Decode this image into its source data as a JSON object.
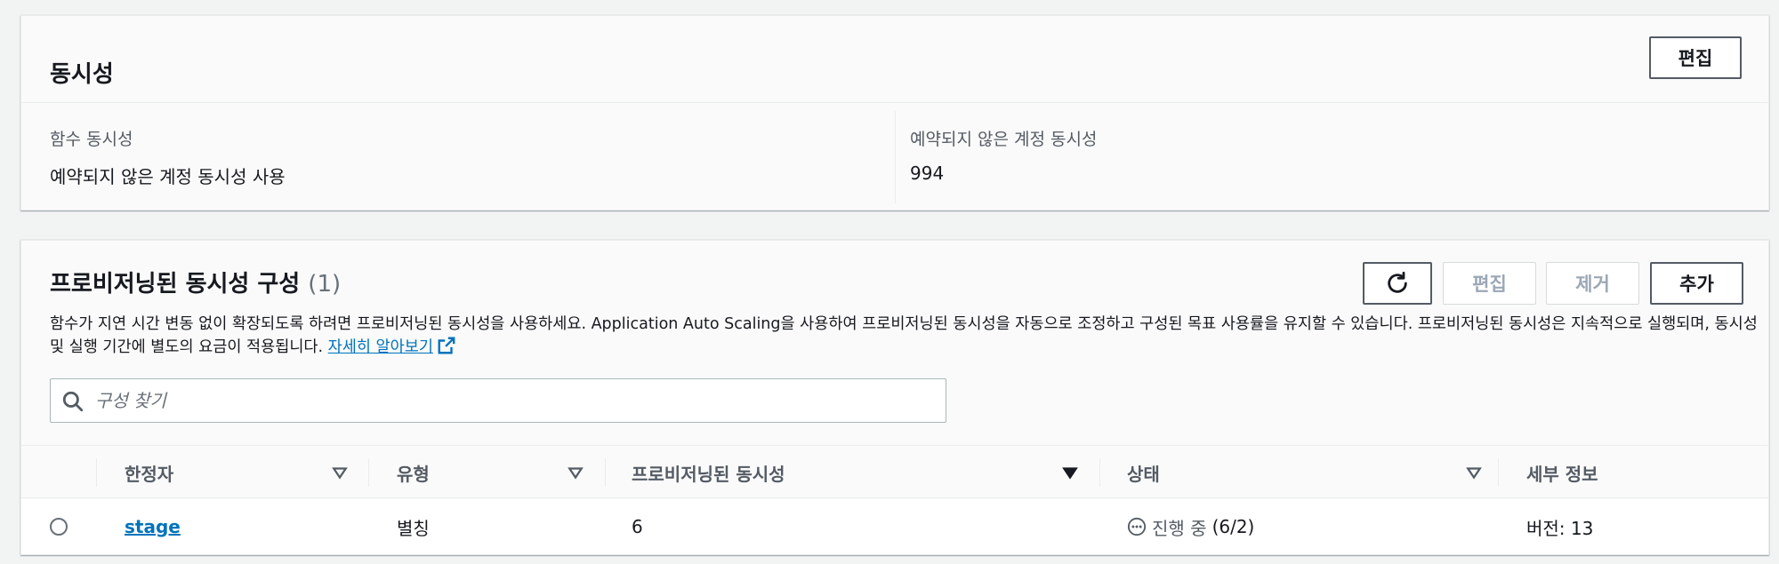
{
  "concurrency": {
    "title": "동시성",
    "edit_label": "편집",
    "function_concurrency_label": "함수 동시성",
    "function_concurrency_value": "예약되지 않은 계정 동시성 사용",
    "unreserved_label": "예약되지 않은 계정 동시성",
    "unreserved_value": "994"
  },
  "provisioned": {
    "title": "프로비저닝된 동시성 구성",
    "count": "(1)",
    "description": "함수가 지연 시간 변동 없이 확장되도록 하려면 프로비저닝된 동시성을 사용하세요. Application Auto Scaling을 사용하여 프로비저닝된 동시성을 자동으로 조정하고 구성된 목표 사용률을 유지할 수 있습니다. 프로비저닝된 동시성은 지속적으로 실행되며, 동시성 및 실행 기간에 별도의 요금이 적용됩니다.",
    "learn_more": "자세히 알아보기",
    "buttons": {
      "refresh_icon": "refresh-icon",
      "edit": "편집",
      "remove": "제거",
      "add": "추가"
    },
    "search": {
      "placeholder": "구성 찾기",
      "value": ""
    },
    "table": {
      "columns": [
        "한정자",
        "유형",
        "프로비저닝된 동시성",
        "상태",
        "세부 정보"
      ],
      "rows": [
        {
          "qualifier": "stage",
          "type": "별칭",
          "provisioned_concurrency": "6",
          "status": "진행 중",
          "status_count": "(6/2)",
          "details": "버전: 13"
        }
      ]
    }
  },
  "colors": {
    "link": "#0073bb",
    "background": "#f2f3f3",
    "panel": "#fafafa"
  }
}
